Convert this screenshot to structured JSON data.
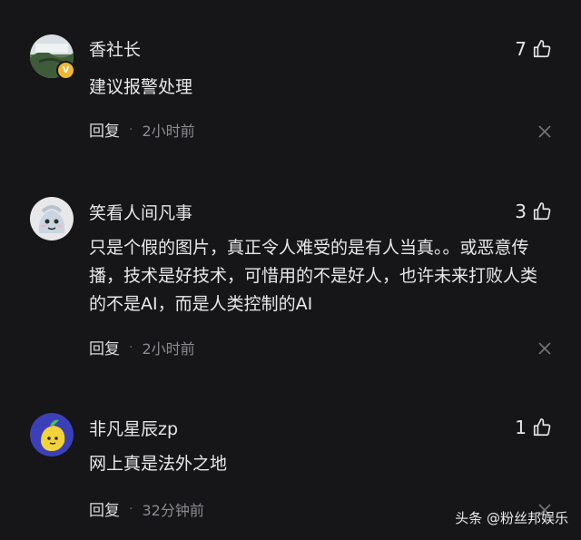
{
  "comments": [
    {
      "username": "香社长",
      "likes": "7",
      "text": "建议报警处理",
      "reply_label": "回复",
      "time": "2小时前",
      "avatar_badge": "V"
    },
    {
      "username": "笑看人间凡事",
      "likes": "3",
      "text": "只是个假的图片，真正令人难受的是有人当真。。或恶意传播，技术是好技术，可惜用的不是好人，也许未来打败人类的不是AI，而是人类控制的AI",
      "reply_label": "回复",
      "time": "2小时前"
    },
    {
      "username": "非凡星辰zp",
      "likes": "1",
      "text": "网上真是法外之地",
      "reply_label": "回复",
      "time": "32分钟前"
    }
  ],
  "separator": "·",
  "watermark": "头条 @粉丝邦娱乐",
  "colors": {
    "background": "#161618",
    "text": "#e9e9ea",
    "muted": "#8b8b90",
    "badge": "#f0b730"
  }
}
